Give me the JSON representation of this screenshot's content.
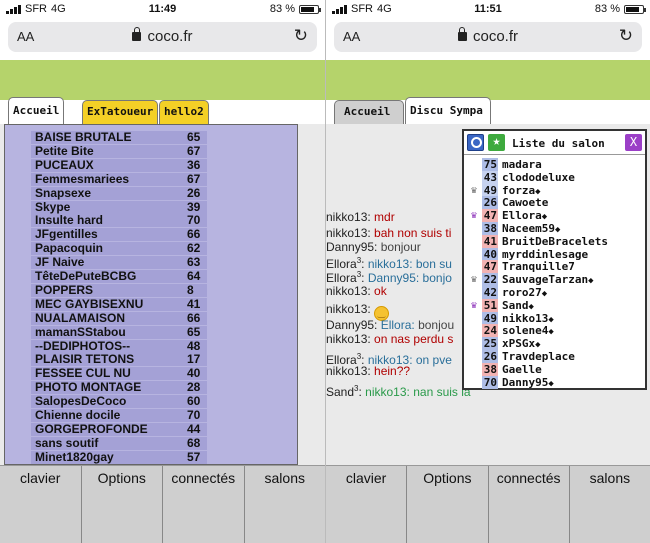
{
  "left": {
    "status": {
      "carrier": "SFR",
      "network": "4G",
      "time": "11:49",
      "battery": "83 %"
    },
    "browser": {
      "aa": "AA",
      "url": "coco.fr",
      "reload": "↻"
    },
    "tabs": [
      "Accueil",
      "ExTatoueur",
      "hello2"
    ],
    "users": [
      {
        "name": "BAISE BRUTALE",
        "age": "65"
      },
      {
        "name": "Petite Bite",
        "age": "67"
      },
      {
        "name": "PUCEAUX",
        "age": "36"
      },
      {
        "name": "Femmesmariees",
        "age": "67"
      },
      {
        "name": "Snapsexe",
        "age": "26"
      },
      {
        "name": "Skype",
        "age": "39"
      },
      {
        "name": "Insulte hard",
        "age": "70"
      },
      {
        "name": "JFgentilles",
        "age": "66"
      },
      {
        "name": "Papacoquin",
        "age": "62"
      },
      {
        "name": "JF Naive",
        "age": "63"
      },
      {
        "name": "TêteDePuteBCBG",
        "age": "64"
      },
      {
        "name": "POPPERS",
        "age": "8"
      },
      {
        "name": "MEC GAYBISEXNU",
        "age": "41"
      },
      {
        "name": "NUALAMAISON",
        "age": "66"
      },
      {
        "name": "mamanSStabou",
        "age": "65"
      },
      {
        "name": "--DEDIPHOTOS--",
        "age": "48"
      },
      {
        "name": "PLAISIR TETONS",
        "age": "17"
      },
      {
        "name": "FESSEE CUL NU",
        "age": "40"
      },
      {
        "name": "PHOTO MONTAGE",
        "age": "28"
      },
      {
        "name": "SalopesDeCoco",
        "age": "60"
      },
      {
        "name": "Chienne docile",
        "age": "70"
      },
      {
        "name": "GORGEPROFONDE",
        "age": "44"
      },
      {
        "name": "sans soutif",
        "age": "68"
      },
      {
        "name": "Minet1820gay",
        "age": "57"
      }
    ],
    "buttons": [
      "clavier",
      "Options",
      "connectés",
      "salons"
    ]
  },
  "right": {
    "status": {
      "carrier": "SFR",
      "network": "4G",
      "time": "11:51",
      "battery": "83 %"
    },
    "browser": {
      "aa": "AA",
      "url": "coco.fr",
      "reload": "↻"
    },
    "tabs": [
      "Accueil",
      "Discu Sympa"
    ],
    "messages": [
      {
        "user": "nikko13:",
        "text": "mdr"
      },
      {
        "user": "nikko13:",
        "text": "bah non suis ti"
      },
      {
        "user": "Danny95:",
        "text": "bonjour"
      },
      {
        "user": "Ellora",
        "sup": "3",
        "to": "nikko13:",
        "text": "bon su"
      },
      {
        "user": "Ellora",
        "sup": "3",
        "to": "Danny95:",
        "text": "bonjo"
      },
      {
        "user": "nikko13:",
        "text": "ok"
      },
      {
        "user": "nikko13:",
        "text": ""
      },
      {
        "user": "Danny95:",
        "to": "Ellora:",
        "text": "bonjou"
      },
      {
        "user": "nikko13:",
        "text": "on nas perdu s"
      },
      {
        "user": "Ellora",
        "sup": "3",
        "to": "nikko13:",
        "text": "on pve"
      },
      {
        "user": "nikko13:",
        "text": "hein??"
      },
      {
        "user": "Sand",
        "sup": "3",
        "to": "nikko13:",
        "text": "nan suis la"
      }
    ],
    "salon": {
      "title": "Liste du salon",
      "close": "X",
      "star": "★",
      "users": [
        {
          "age": "75",
          "name": "madara",
          "crown": "",
          "color": "b"
        },
        {
          "age": "43",
          "name": "clododeluxe",
          "crown": "",
          "color": "lb"
        },
        {
          "age": "49",
          "name": "forza",
          "crown": "♛",
          "color": "lb",
          "mark": "◆"
        },
        {
          "age": "26",
          "name": "Cawoete",
          "crown": "",
          "color": "b"
        },
        {
          "age": "47",
          "name": "Ellora",
          "crown": "♛",
          "color": "p",
          "mark": "◆"
        },
        {
          "age": "38",
          "name": "Naceem59",
          "crown": "",
          "color": "b",
          "mark": "◆"
        },
        {
          "age": "41",
          "name": "BruitDeBracelets",
          "crown": "",
          "color": "p"
        },
        {
          "age": "40",
          "name": "myrddinlesage",
          "crown": "",
          "color": "b"
        },
        {
          "age": "47",
          "name": "Tranquille7",
          "crown": "",
          "color": "p"
        },
        {
          "age": "22",
          "name": "SauvageTarzan",
          "crown": "♛",
          "color": "b",
          "mark": "◆"
        },
        {
          "age": "42",
          "name": "roro27",
          "crown": "",
          "color": "b",
          "mark": "◆"
        },
        {
          "age": "51",
          "name": "Sand",
          "crown": "♛",
          "color": "p",
          "mark": "◆"
        },
        {
          "age": "49",
          "name": "nikko13",
          "crown": "",
          "color": "b",
          "mark": "◆"
        },
        {
          "age": "24",
          "name": "solene4",
          "crown": "",
          "color": "p",
          "mark": "◆"
        },
        {
          "age": "25",
          "name": "xPSGx",
          "crown": "",
          "color": "b",
          "mark": "◆"
        },
        {
          "age": "26",
          "name": "Travdeplace",
          "crown": "",
          "color": "b"
        },
        {
          "age": "38",
          "name": "Gaelle",
          "crown": "",
          "color": "p"
        },
        {
          "age": "70",
          "name": "Danny95",
          "crown": "",
          "color": "b",
          "mark": "◆"
        }
      ]
    },
    "buttons": [
      "clavier",
      "Options",
      "connectés",
      "salons"
    ]
  },
  "colors": {
    "green_band": "#b5d36b",
    "user_panel": "#b7b4e0",
    "tab_yellow": "#f4d026",
    "message_red": "#b00000",
    "crown_purple": "#8b2fb8"
  },
  "battery_level": 0.83
}
